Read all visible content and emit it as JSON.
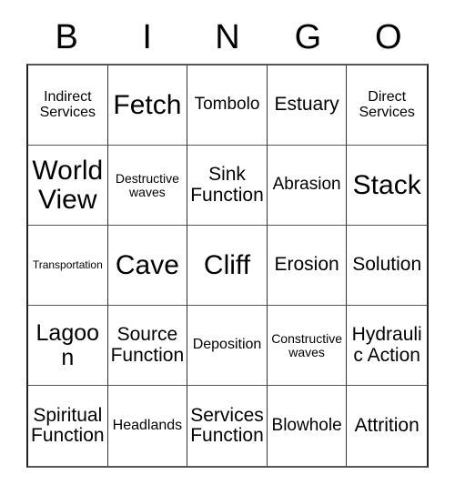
{
  "card": {
    "header_letters": [
      "B",
      "I",
      "N",
      "G",
      "O"
    ],
    "grid": {
      "rows": [
        {
          "cells": [
            {
              "text": "Indirect Services",
              "size": "sm"
            },
            {
              "text": "Fetch",
              "size": "xxl"
            },
            {
              "text": "Tombolo",
              "size": "md"
            },
            {
              "text": "Estuary",
              "size": "lg"
            },
            {
              "text": "Direct Services",
              "size": "sm"
            }
          ]
        },
        {
          "cells": [
            {
              "text": "World View",
              "size": "xxl"
            },
            {
              "text": "Destructive waves",
              "size": "xs"
            },
            {
              "text": "Sink Function",
              "size": "lg"
            },
            {
              "text": "Abrasion",
              "size": "md"
            },
            {
              "text": "Stack",
              "size": "xxl"
            }
          ]
        },
        {
          "cells": [
            {
              "text": "Transportation",
              "size": "xxs"
            },
            {
              "text": "Cave",
              "size": "xxl"
            },
            {
              "text": "Cliff",
              "size": "xxl"
            },
            {
              "text": "Erosion",
              "size": "lg"
            },
            {
              "text": "Solution",
              "size": "lg"
            }
          ]
        },
        {
          "cells": [
            {
              "text": "Lagoon",
              "size": "xl"
            },
            {
              "text": "Source Function",
              "size": "lg"
            },
            {
              "text": "Deposition",
              "size": "sm"
            },
            {
              "text": "Constructive waves",
              "size": "xs"
            },
            {
              "text": "Hydraulic Action",
              "size": "lg"
            }
          ]
        },
        {
          "cells": [
            {
              "text": "Spiritual Function",
              "size": "lg"
            },
            {
              "text": "Headlands",
              "size": "sm"
            },
            {
              "text": "Services Function",
              "size": "lg"
            },
            {
              "text": "Blowhole",
              "size": "md"
            },
            {
              "text": "Attrition",
              "size": "lg"
            }
          ]
        }
      ]
    }
  }
}
